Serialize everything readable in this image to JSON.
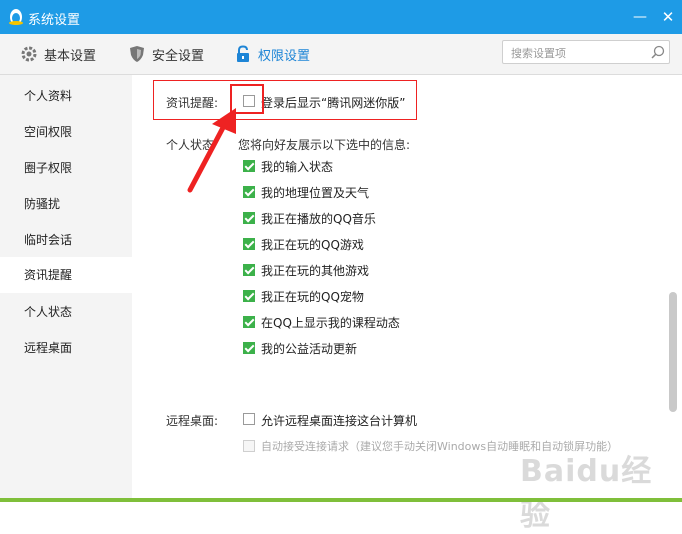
{
  "window": {
    "title": "系统设置",
    "minimize_glyph": "—",
    "close_glyph": "✕"
  },
  "toolbar": {
    "tabs": [
      {
        "label": "基本设置",
        "icon": "gear-icon"
      },
      {
        "label": "安全设置",
        "icon": "shield-icon"
      },
      {
        "label": "权限设置",
        "icon": "lock-icon"
      }
    ],
    "active_tab": "权限设置"
  },
  "search": {
    "placeholder": "搜索设置项",
    "value": ""
  },
  "sidebar": {
    "items": [
      {
        "label": "个人资料"
      },
      {
        "label": "空间权限"
      },
      {
        "label": "圈子权限"
      },
      {
        "label": "防骚扰"
      },
      {
        "label": "临时会话"
      },
      {
        "label": "资讯提醒"
      },
      {
        "label": "个人状态"
      },
      {
        "label": "远程桌面"
      }
    ],
    "active_item": "资讯提醒"
  },
  "news": {
    "label": "资讯提醒:",
    "option": {
      "label": "登录后显示“腾讯网迷你版”",
      "checked": false
    }
  },
  "status": {
    "label": "个人状态",
    "description": "您将向好友展示以下选中的信息:",
    "options": [
      {
        "label": "我的输入状态",
        "checked": true
      },
      {
        "label": "我的地理位置及天气",
        "checked": true
      },
      {
        "label": "我正在播放的QQ音乐",
        "checked": true
      },
      {
        "label": "我正在玩的QQ游戏",
        "checked": true
      },
      {
        "label": "我正在玩的其他游戏",
        "checked": true
      },
      {
        "label": "我正在玩的QQ宠物",
        "checked": true
      },
      {
        "label": "在QQ上显示我的课程动态",
        "checked": true
      },
      {
        "label": "我的公益活动更新",
        "checked": true
      }
    ]
  },
  "remote": {
    "label": "远程桌面:",
    "options": [
      {
        "label": "允许远程桌面连接这台计算机",
        "checked": false,
        "disabled": false
      },
      {
        "label": "自动接受连接请求（建议您手动关闭Windows自动睡眠和自动锁屏功能）",
        "checked": false,
        "disabled": true
      }
    ]
  },
  "watermark": "Baidu经验",
  "colors": {
    "titlebar": "#1e9be6",
    "accent": "#1e85d6",
    "check": "#3cb14a",
    "annotation": "#ee2222"
  }
}
